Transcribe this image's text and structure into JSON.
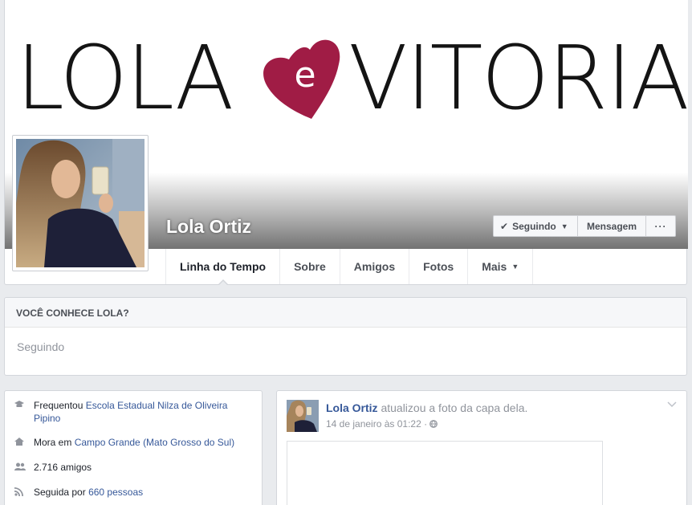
{
  "cover": {
    "logo_left": "LOLA",
    "logo_heart_letter": "e",
    "logo_right": "VITORIA",
    "heart_color": "#a01c45"
  },
  "profile": {
    "name": "Lola Ortiz"
  },
  "actions": {
    "following": "Seguindo",
    "message": "Mensagem",
    "more": "···"
  },
  "tabs": [
    {
      "label": "Linha do Tempo"
    },
    {
      "label": "Sobre"
    },
    {
      "label": "Amigos"
    },
    {
      "label": "Fotos"
    },
    {
      "label": "Mais"
    }
  ],
  "know": {
    "title": "VOCÊ CONHECE LOLA?",
    "status": "Seguindo"
  },
  "about": {
    "studied_prefix": "Frequentou",
    "studied_link": "Escola Estadual Nilza de Oliveira Pipino",
    "lives_prefix": "Mora em",
    "lives_link": "Campo Grande (Mato Grosso do Sul)",
    "friends": "2.716 amigos",
    "followers_prefix": "Seguida por",
    "followers_link": "660 pessoas"
  },
  "post": {
    "author": "Lola Ortiz",
    "action": "atualizou a foto da capa dela.",
    "timestamp": "14 de janeiro às 01:22",
    "privacy_icon": "globe-icon"
  },
  "colors": {
    "link": "#365899",
    "background": "#e9ebee"
  }
}
